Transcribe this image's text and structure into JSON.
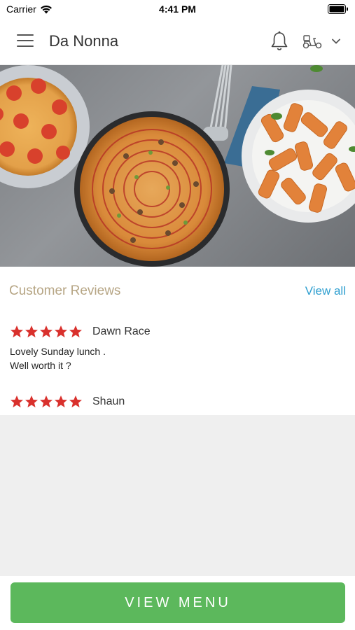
{
  "status_bar": {
    "carrier": "Carrier",
    "time": "4:41 PM"
  },
  "header": {
    "title": "Da Nonna",
    "icons": [
      "menu-icon",
      "bell-icon",
      "delivery-scooter-icon",
      "chevron-down-icon"
    ]
  },
  "hero": {
    "description_icon": "food-photo"
  },
  "reviews": {
    "title": "Customer Reviews",
    "view_all": "View all",
    "items": [
      {
        "name": "Dawn Race",
        "rating": 5,
        "text": "Lovely Sunday lunch .\nWell worth it ?"
      },
      {
        "name": "Shaun",
        "rating": 5,
        "text": ""
      }
    ]
  },
  "footer": {
    "button_label": "VIEW MENU"
  },
  "colors": {
    "accent": "#5cb85c",
    "star": "#d9312d",
    "link": "#2f9fd0",
    "section_title": "#b6a584"
  }
}
